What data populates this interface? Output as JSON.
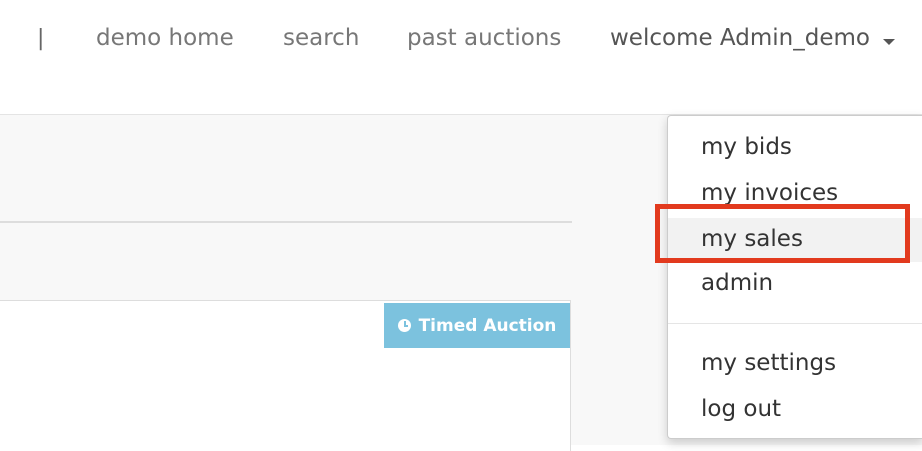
{
  "navbar": {
    "divider": "|",
    "home_label": "demo home",
    "search_label": "search",
    "past_label": "past auctions",
    "user_label": "welcome Admin_demo"
  },
  "badge": {
    "label": "Timed Auction",
    "color": "#7cc2de"
  },
  "dropdown": {
    "items": [
      {
        "label": "my bids"
      },
      {
        "label": "my invoices"
      },
      {
        "label": "my sales"
      },
      {
        "label": "admin"
      },
      {
        "label": "my settings"
      },
      {
        "label": "log out"
      }
    ],
    "highlight_color": "#e23a1e"
  }
}
